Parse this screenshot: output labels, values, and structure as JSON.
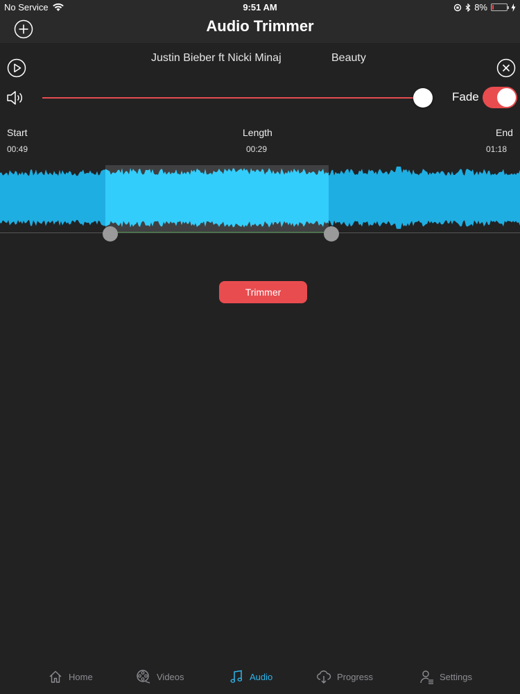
{
  "status_bar": {
    "carrier": "No Service",
    "time": "9:51 AM",
    "battery": "8%",
    "battery_level": 0.08
  },
  "nav": {
    "title": "Audio Trimmer"
  },
  "track": {
    "artist": "Justin Bieber ft Nicki Minaj",
    "title": "Beauty"
  },
  "volume": {
    "level": 1.0
  },
  "fade": {
    "label": "Fade",
    "enabled": true
  },
  "times": {
    "start_label": "Start",
    "start_value": "00:49",
    "length_label": "Length",
    "length_value": "00:29",
    "end_label": "End",
    "end_value": "01:18"
  },
  "actions": {
    "trim_label": "Trimmer"
  },
  "tabs": [
    {
      "label": "Home",
      "icon": "home-icon",
      "active": false
    },
    {
      "label": "Videos",
      "icon": "film-reel-icon",
      "active": false
    },
    {
      "label": "Audio",
      "icon": "music-note-icon",
      "active": true
    },
    {
      "label": "Progress",
      "icon": "cloud-download-icon",
      "active": false
    },
    {
      "label": "Settings",
      "icon": "user-settings-icon",
      "active": false
    }
  ],
  "colors": {
    "accent": "#e84c4f",
    "waveform": "#1faee2",
    "waveform_selected": "#33cdfb",
    "tab_active": "#2fb6ea"
  }
}
